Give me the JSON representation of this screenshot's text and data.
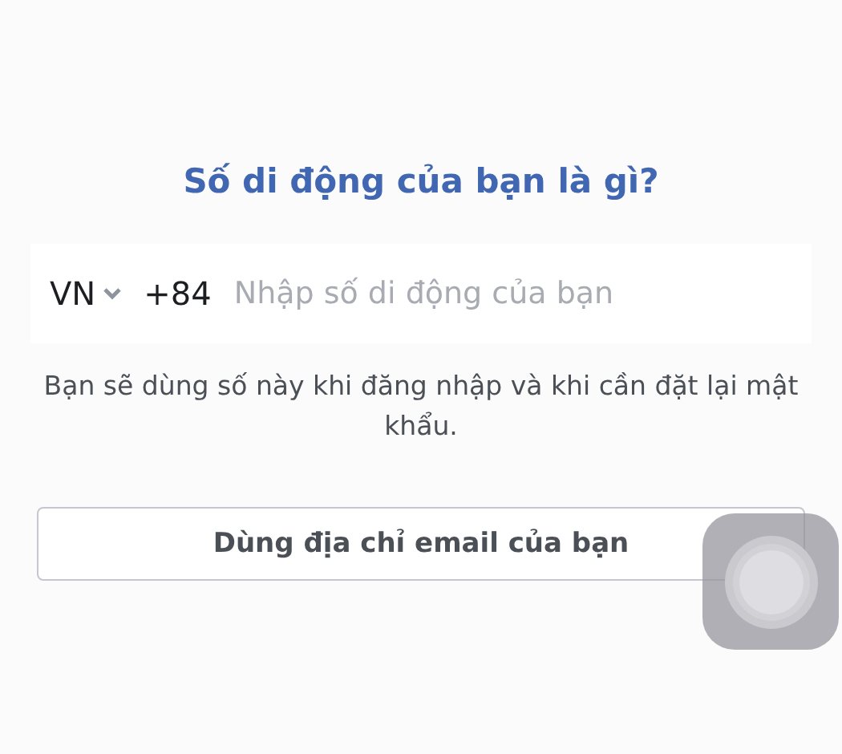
{
  "title": "Số di động của bạn là gì?",
  "phone": {
    "country": "VN",
    "dial_code": "+84",
    "placeholder": "Nhập số di động của bạn"
  },
  "help_text": "Bạn sẽ dùng số này khi đăng nhập và khi cần đặt lại mật khẩu.",
  "buttons": [
    {
      "label": "Dùng địa chỉ email của bạn"
    }
  ],
  "assistive_touch": {
    "kind": "floating"
  }
}
